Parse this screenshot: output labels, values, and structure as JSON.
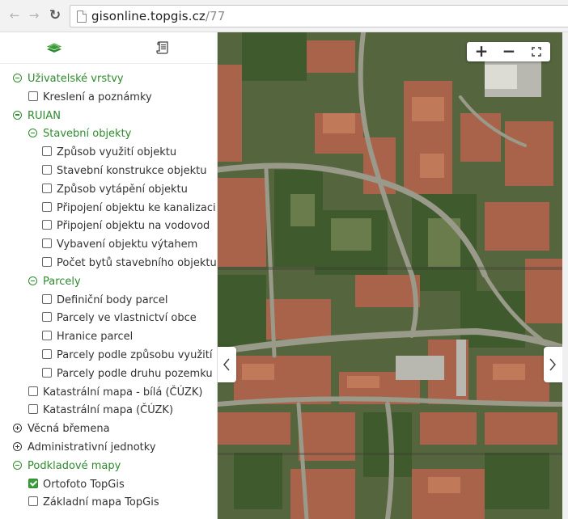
{
  "browser": {
    "back_icon": "arrow-left-icon",
    "forward_icon": "arrow-right-icon",
    "reload_icon": "reload-icon",
    "url_host": "gisonline.topgis.cz",
    "url_path": "/77"
  },
  "sidebar": {
    "tabs": [
      {
        "icon": "layers-icon",
        "active": true
      },
      {
        "icon": "legend-scroll-icon",
        "active": false
      }
    ],
    "tree": [
      {
        "type": "group",
        "label": "Uživatelské vrstvy",
        "level": 0,
        "expanded": true
      },
      {
        "type": "layer",
        "label": "Kreslení a poznámky",
        "level": 1,
        "checked": false
      },
      {
        "type": "group",
        "label": "RUIAN",
        "level": 0,
        "expanded": true
      },
      {
        "type": "group",
        "label": "Stavební objekty",
        "level": 1,
        "expanded": true
      },
      {
        "type": "layer",
        "label": "Způsob využití objektu",
        "level": 2,
        "checked": false
      },
      {
        "type": "layer",
        "label": "Stavební konstrukce objektu",
        "level": 2,
        "checked": false
      },
      {
        "type": "layer",
        "label": "Způsob vytápění objektu",
        "level": 2,
        "checked": false
      },
      {
        "type": "layer",
        "label": "Připojení objektu ke kanalizaci",
        "level": 2,
        "checked": false
      },
      {
        "type": "layer",
        "label": "Připojení objektu na vodovod",
        "level": 2,
        "checked": false
      },
      {
        "type": "layer",
        "label": "Vybavení objektu výtahem",
        "level": 2,
        "checked": false
      },
      {
        "type": "layer",
        "label": "Počet bytů stavebního objektu",
        "level": 2,
        "checked": false
      },
      {
        "type": "group",
        "label": "Parcely",
        "level": 1,
        "expanded": true
      },
      {
        "type": "layer",
        "label": "Definiční body parcel",
        "level": 2,
        "checked": false
      },
      {
        "type": "layer",
        "label": "Parcely ve vlastnictví obce",
        "level": 2,
        "checked": false
      },
      {
        "type": "layer",
        "label": "Hranice parcel",
        "level": 2,
        "checked": false
      },
      {
        "type": "layer",
        "label": "Parcely podle způsobu využití",
        "level": 2,
        "checked": false
      },
      {
        "type": "layer",
        "label": "Parcely podle druhu pozemku",
        "level": 2,
        "checked": false
      },
      {
        "type": "layer",
        "label": "Katastrální mapa - bílá (ČÚZK)",
        "level": 1,
        "checked": false
      },
      {
        "type": "layer",
        "label": "Katastrální mapa (ČÚZK)",
        "level": 1,
        "checked": false
      },
      {
        "type": "group",
        "label": "Věcná břemena",
        "level": 0,
        "expanded": false
      },
      {
        "type": "group",
        "label": "Administrativní jednotky",
        "level": 0,
        "expanded": false
      },
      {
        "type": "group",
        "label": "Podkladové mapy",
        "level": 0,
        "expanded": true
      },
      {
        "type": "layer",
        "label": "Ortofoto TopGis",
        "level": 1,
        "checked": true
      },
      {
        "type": "layer",
        "label": "Základní mapa TopGis",
        "level": 1,
        "checked": false
      }
    ]
  },
  "map": {
    "zoom_in_label": "+",
    "zoom_out_label": "−",
    "fullscreen_icon": "fullscreen-icon",
    "left_arrow_icon": "chevron-left-icon",
    "right_arrow_icon": "chevron-right-icon"
  },
  "colors": {
    "accent_green": "#2e8b2e",
    "checked_green": "#3a9c3a"
  }
}
